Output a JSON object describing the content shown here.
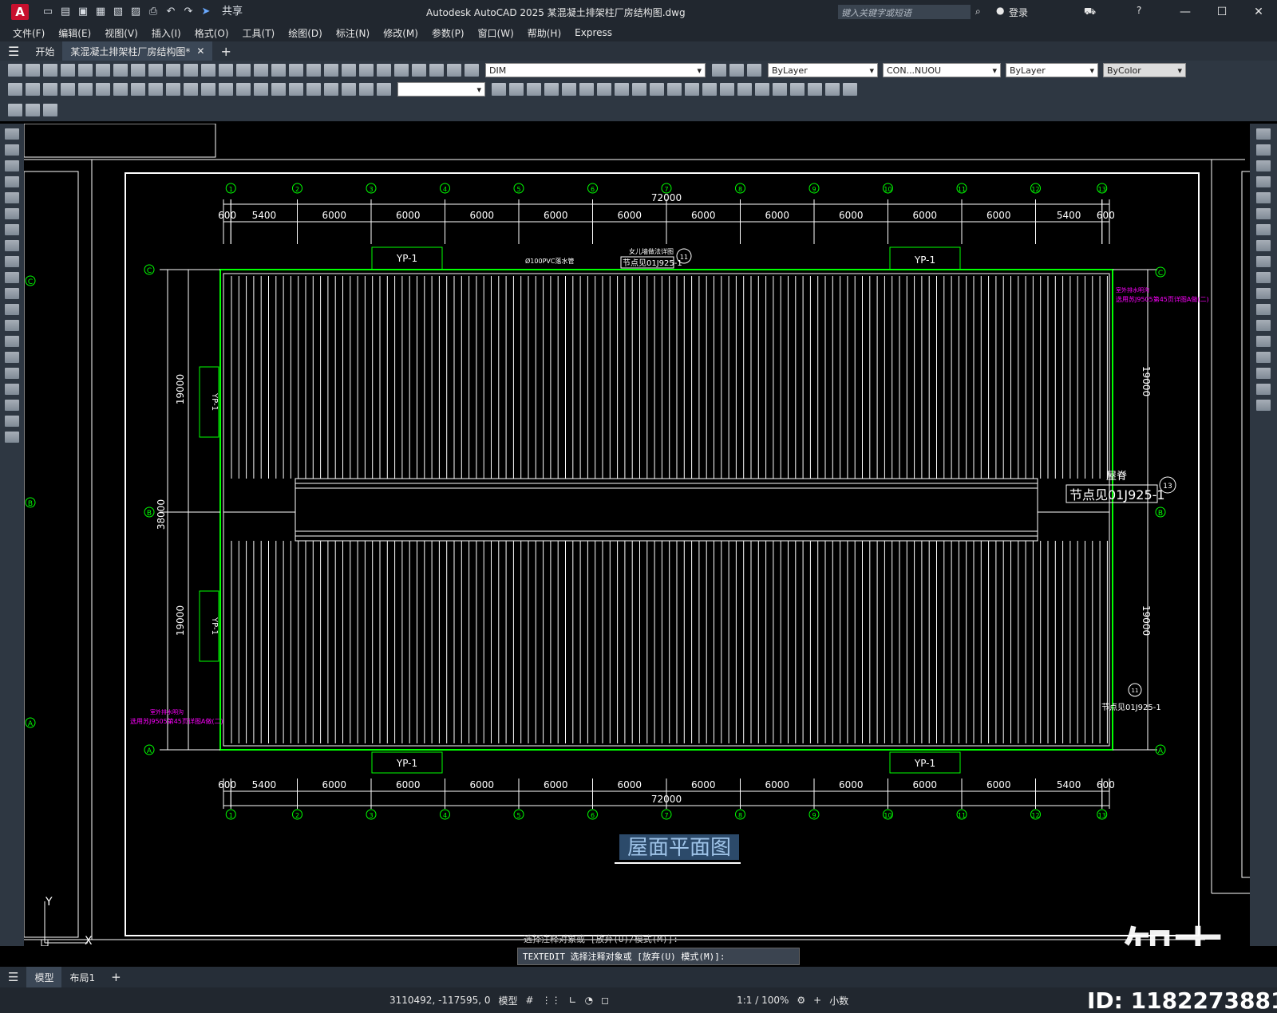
{
  "window": {
    "app_title": "Autodesk AutoCAD 2025    某混凝土排架柱厂房结构图.dwg",
    "search_placeholder": "键入关键字或短语",
    "login_label": "登录",
    "share_label": "共享",
    "logo_letter": "A"
  },
  "menu": [
    "文件(F)",
    "编辑(E)",
    "视图(V)",
    "插入(I)",
    "格式(O)",
    "工具(T)",
    "绘图(D)",
    "标注(N)",
    "修改(M)",
    "参数(P)",
    "窗口(W)",
    "帮助(H)",
    "Express"
  ],
  "tabs": {
    "start": "开始",
    "file": "某混凝土排架柱厂房结构图*"
  },
  "layers": {
    "current_layer": "DIM",
    "color": "ByLayer",
    "linetype": "CON...NUOU",
    "lineweight": "ByLayer",
    "plotstyle": "ByColor"
  },
  "drawing": {
    "overall_dim": "72000",
    "top_spans": [
      "600",
      "5400",
      "6000",
      "6000",
      "6000",
      "6000",
      "6000",
      "6000",
      "6000",
      "6000",
      "6000",
      "6000",
      "5400",
      "600"
    ],
    "bottom_spans": [
      "600",
      "5400",
      "6000",
      "6000",
      "6000",
      "6000",
      "6000",
      "6000",
      "6000",
      "6000",
      "6000",
      "6000",
      "5400",
      "600"
    ],
    "axis_numbers": [
      "1",
      "2",
      "3",
      "4",
      "5",
      "6",
      "7",
      "8",
      "9",
      "10",
      "11",
      "12",
      "13"
    ],
    "axis_letters": [
      "C",
      "B",
      "A"
    ],
    "side_dims": {
      "upper": "19000",
      "lower": "19000",
      "total": "38000"
    },
    "yp_label": "YP-1",
    "ridge_label": "屋脊",
    "node_note": "节点见01J925-1",
    "node_note_small": "节点见01J925-1",
    "node_title_small": "女儿墙做法详图",
    "node_circle": "13",
    "node_circle_small": "11",
    "pipe_note": "Ø100PVC落水管",
    "gutter_note_title": "室外排水明沟",
    "gutter_note": "选用苏J9505第45页详图A做(二)",
    "drawing_title": "屋面平面图",
    "ucs_y": "Y",
    "ucs_x": "X"
  },
  "command": {
    "history": "选择注释对象或 [放弃(U)/模式(M)]:",
    "prompt": "TEXTEDIT 选择注释对象或 [放弃(U) 模式(M)]:"
  },
  "layout_tabs": {
    "model": "模型",
    "layout1": "布局1"
  },
  "status": {
    "coords": "3110492, -117595, 0",
    "mode": "模型",
    "scale": "1:1 / 100%",
    "units": "小数"
  },
  "watermark": {
    "brand": "知末",
    "id": "ID: 1182273881"
  },
  "colors": {
    "green": "#00ff00",
    "magenta": "#ff00ff",
    "white": "#ffffff"
  }
}
